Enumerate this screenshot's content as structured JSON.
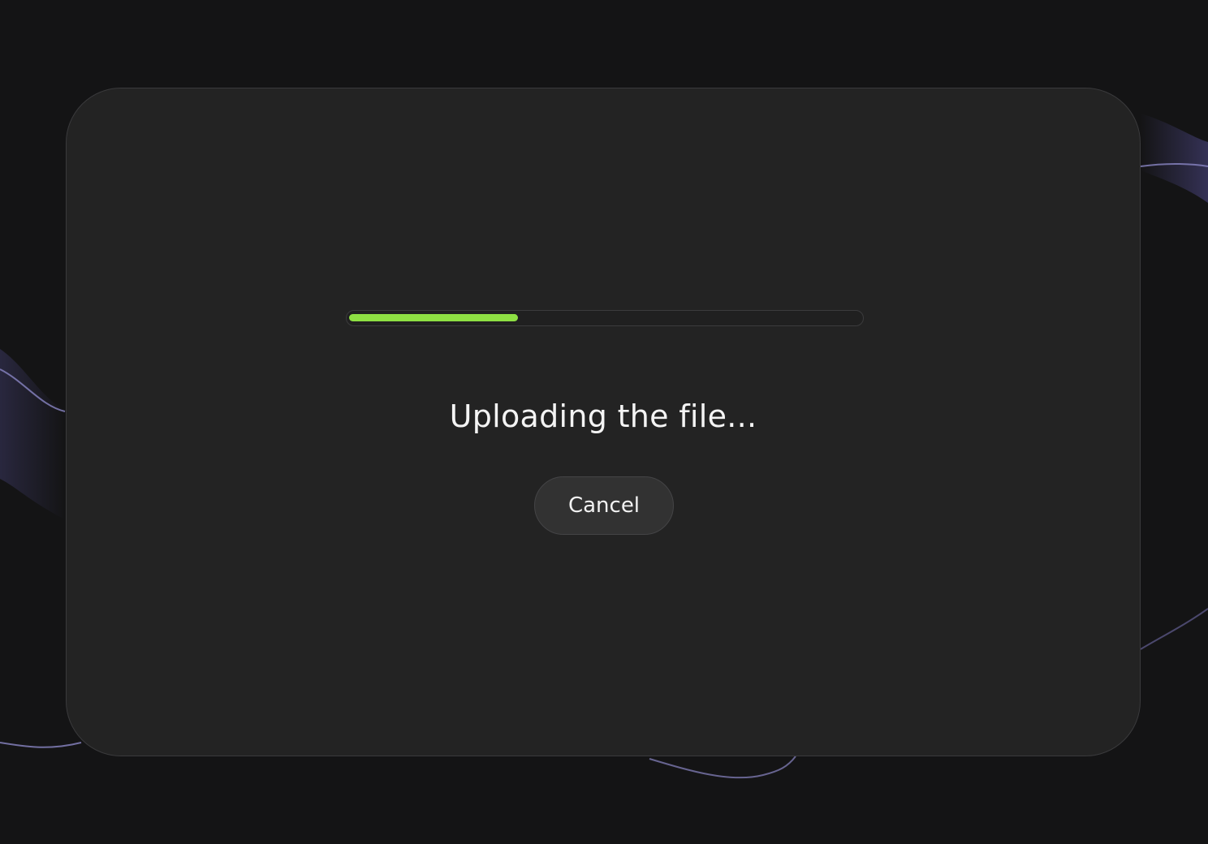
{
  "upload": {
    "progress_fraction": 0.33,
    "status_text": "Uploading the file...",
    "cancel_label": "Cancel"
  },
  "colors": {
    "background": "#141415",
    "card": "#232323",
    "progress_fill": "#8ee043",
    "wave_line": "#8a86c4"
  },
  "icons": {
    "backdrop": "wave-lines-decoration"
  }
}
